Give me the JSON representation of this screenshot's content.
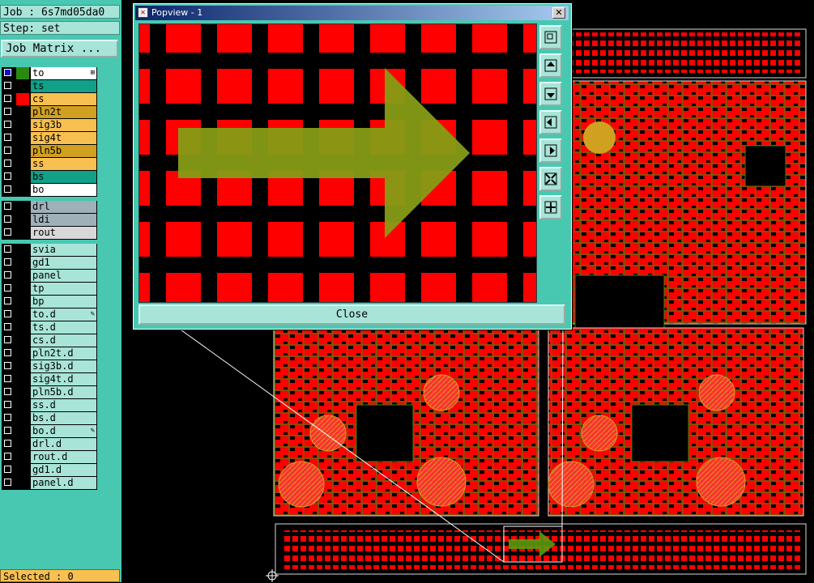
{
  "job_label": "Job : 6s7md05da0",
  "step_label": "Step: set",
  "job_matrix_label": "Job Matrix ...",
  "layers_group1": [
    {
      "name": "to",
      "checked": true,
      "swatch": "#2a8a10",
      "color": "#ffffff",
      "marker": "⊞"
    },
    {
      "name": "ts",
      "checked": false,
      "swatch": "#000000",
      "color": "#11a088",
      "marker": ""
    },
    {
      "name": "cs",
      "checked": false,
      "swatch": "#ff0000",
      "color": "#f8c050",
      "marker": ""
    },
    {
      "name": "pln2t",
      "checked": false,
      "swatch": "#000000",
      "color": "#d0a020",
      "marker": ""
    },
    {
      "name": "sig3b",
      "checked": false,
      "swatch": "#000000",
      "color": "#f8c050",
      "marker": ""
    },
    {
      "name": "sig4t",
      "checked": false,
      "swatch": "#000000",
      "color": "#f8c050",
      "marker": ""
    },
    {
      "name": "pln5b",
      "checked": false,
      "swatch": "#000000",
      "color": "#d0a020",
      "marker": ""
    },
    {
      "name": "ss",
      "checked": false,
      "swatch": "#000000",
      "color": "#f8c050",
      "marker": ""
    },
    {
      "name": "bs",
      "checked": false,
      "swatch": "#000000",
      "color": "#11a088",
      "marker": ""
    },
    {
      "name": "bo",
      "checked": false,
      "swatch": "#000000",
      "color": "#ffffff",
      "marker": ""
    }
  ],
  "layers_group2": [
    {
      "name": "drl",
      "checked": false,
      "swatch": "#000000",
      "color": "#a0b0b8",
      "marker": ""
    },
    {
      "name": "ldi",
      "checked": false,
      "swatch": "#000000",
      "color": "#a0b0b8",
      "marker": ""
    },
    {
      "name": "rout",
      "checked": false,
      "swatch": "#000000",
      "color": "#d8d8d8",
      "marker": ""
    }
  ],
  "layers_group3": [
    {
      "name": "svia",
      "checked": false,
      "swatch": "#000000",
      "color": "#a8e4d8",
      "marker": ""
    },
    {
      "name": "gd1",
      "checked": false,
      "swatch": "#000000",
      "color": "#a8e4d8",
      "marker": ""
    },
    {
      "name": "panel",
      "checked": false,
      "swatch": "#000000",
      "color": "#a8e4d8",
      "marker": ""
    },
    {
      "name": "tp",
      "checked": false,
      "swatch": "#000000",
      "color": "#a8e4d8",
      "marker": ""
    },
    {
      "name": "bp",
      "checked": false,
      "swatch": "#000000",
      "color": "#a8e4d8",
      "marker": ""
    },
    {
      "name": "to.d",
      "checked": false,
      "swatch": "#000000",
      "color": "#a8e4d8",
      "marker": "✎"
    },
    {
      "name": "ts.d",
      "checked": false,
      "swatch": "#000000",
      "color": "#a8e4d8",
      "marker": ""
    },
    {
      "name": "cs.d",
      "checked": false,
      "swatch": "#000000",
      "color": "#a8e4d8",
      "marker": ""
    },
    {
      "name": "pln2t.d",
      "checked": false,
      "swatch": "#000000",
      "color": "#a8e4d8",
      "marker": ""
    },
    {
      "name": "sig3b.d",
      "checked": false,
      "swatch": "#000000",
      "color": "#a8e4d8",
      "marker": ""
    },
    {
      "name": "sig4t.d",
      "checked": false,
      "swatch": "#000000",
      "color": "#a8e4d8",
      "marker": ""
    },
    {
      "name": "pln5b.d",
      "checked": false,
      "swatch": "#000000",
      "color": "#a8e4d8",
      "marker": ""
    },
    {
      "name": "ss.d",
      "checked": false,
      "swatch": "#000000",
      "color": "#a8e4d8",
      "marker": ""
    },
    {
      "name": "bs.d",
      "checked": false,
      "swatch": "#000000",
      "color": "#a8e4d8",
      "marker": ""
    },
    {
      "name": "bo.d",
      "checked": false,
      "swatch": "#000000",
      "color": "#a8e4d8",
      "marker": "✎"
    },
    {
      "name": "drl.d",
      "checked": false,
      "swatch": "#000000",
      "color": "#a8e4d8",
      "marker": ""
    },
    {
      "name": "rout.d",
      "checked": false,
      "swatch": "#000000",
      "color": "#a8e4d8",
      "marker": ""
    },
    {
      "name": "gd1.d",
      "checked": false,
      "swatch": "#000000",
      "color": "#a8e4d8",
      "marker": ""
    },
    {
      "name": "panel.d",
      "checked": false,
      "swatch": "#000000",
      "color": "#a8e4d8",
      "marker": ""
    }
  ],
  "selected_label": "Selected : 0",
  "popup": {
    "title": "Popview - 1",
    "close_label": "Close",
    "toolbar_icons": [
      "zoom-home-icon",
      "pan-up-icon",
      "pan-down-icon",
      "pan-left-icon",
      "pan-right-icon",
      "zoom-in-icon",
      "zoom-out-icon"
    ]
  },
  "colors": {
    "panel_teal": "#48c8b0",
    "panel_light": "#a8e4d8",
    "copper_red": "#ff0000",
    "trace_green": "#2a8a10",
    "arrow_green": "#5a9a10",
    "silkscreen_yellow": "#d0a020"
  }
}
